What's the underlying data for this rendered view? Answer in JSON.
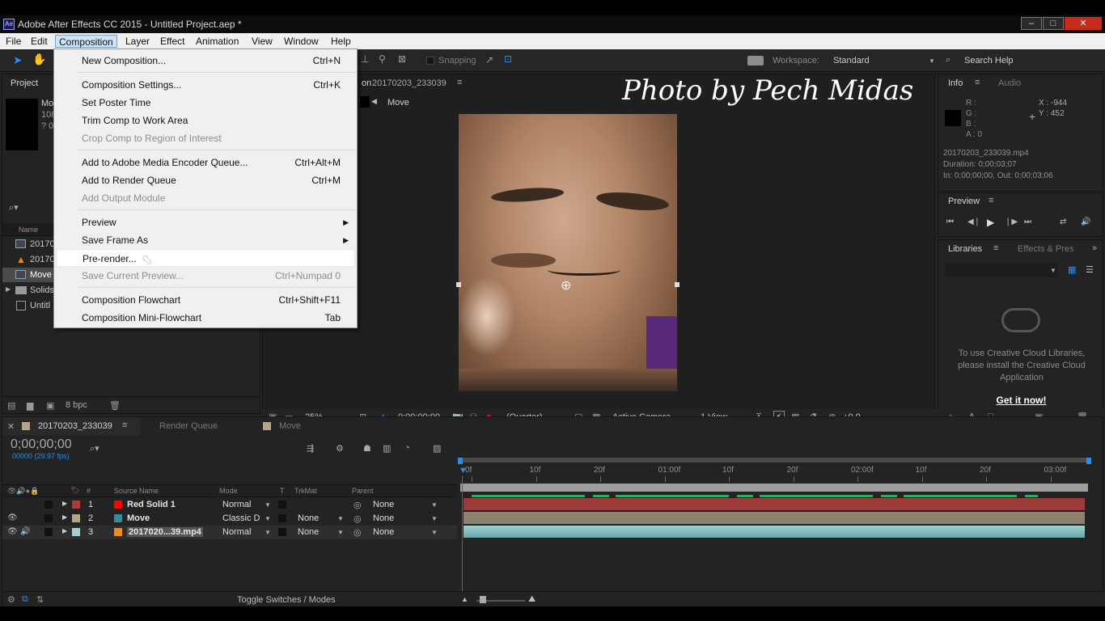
{
  "window": {
    "title": "Adobe After Effects CC 2015 - Untitled Project.aep *",
    "app_badge": "Ae",
    "min": "–",
    "max": "□",
    "close": "✕"
  },
  "menubar": {
    "items": [
      "File",
      "Edit",
      "Composition",
      "Layer",
      "Effect",
      "Animation",
      "View",
      "Window",
      "Help"
    ],
    "active": "Composition"
  },
  "toolbar": {
    "snapping": "Snapping",
    "workspace_label": "Workspace:",
    "workspace_value": "Standard",
    "search_help": "Search Help"
  },
  "menu": {
    "items": [
      {
        "label": "New Composition...",
        "shortcut": "Ctrl+N"
      },
      {
        "label": "Composition Settings...",
        "shortcut": "Ctrl+K"
      },
      {
        "label": "Set Poster Time",
        "shortcut": ""
      },
      {
        "label": "Trim Comp to Work Area",
        "shortcut": ""
      },
      {
        "label": "Crop Comp to Region of Interest",
        "shortcut": "",
        "disabled": true
      },
      {
        "label": "Add to Adobe Media Encoder Queue...",
        "shortcut": "Ctrl+Alt+M"
      },
      {
        "label": "Add to Render Queue",
        "shortcut": "Ctrl+M"
      },
      {
        "label": "Add Output Module",
        "shortcut": "",
        "disabled": true
      },
      {
        "label": "Preview",
        "shortcut": "",
        "submenu": true
      },
      {
        "label": "Save Frame As",
        "shortcut": "",
        "submenu": true
      },
      {
        "label": "Pre-render...",
        "shortcut": "",
        "highlighted": true
      },
      {
        "label": "Save Current Preview...",
        "shortcut": "Ctrl+Numpad 0",
        "disabled": true
      },
      {
        "label": "Composition Flowchart",
        "shortcut": "Ctrl+Shift+F11"
      },
      {
        "label": "Composition Mini-Flowchart",
        "shortcut": "Tab"
      }
    ]
  },
  "project": {
    "title": "Project",
    "info_name": "Mo",
    "info_line1": "108",
    "info_line2": "? 0;",
    "column_name": "Name",
    "bpc": "8 bpc",
    "items": [
      {
        "name": "20170",
        "icon": "composition-icon"
      },
      {
        "name": "20170",
        "icon": "vlc-footage-icon"
      },
      {
        "name": "Move",
        "icon": "composition-icon",
        "selected": true
      },
      {
        "name": "Solids",
        "icon": "folder-icon"
      },
      {
        "name": "Untitl",
        "icon": "project-file-icon"
      }
    ]
  },
  "composition": {
    "tab_prefix": "on",
    "comp_name": "20170203_233039",
    "breadcrumb": "Move",
    "watermark": "Photo by Pech Midas",
    "zoom": "25%",
    "timecode": "0;00;00;00",
    "resolution": "(Quarter)",
    "camera": "Active Camera",
    "views": "1 View",
    "exposure": "+0.0"
  },
  "info": {
    "tab_info": "Info",
    "tab_audio": "Audio",
    "r": "R :",
    "g": "G :",
    "b": "B :",
    "a": "A : 0",
    "x": "X : -944",
    "y": "Y : 452",
    "file": "20170203_233039.mp4",
    "duration": "Duration: 0;00;03;07",
    "inout": "In: 0;00;00;00, Out: 0;00;03;06"
  },
  "preview": {
    "title": "Preview"
  },
  "libraries": {
    "tab_libraries": "Libraries",
    "tab_effects": "Effects & Pres",
    "message": "To use Creative Cloud Libraries, please install the Creative Cloud Application",
    "link": "Get it now!"
  },
  "timeline": {
    "tabs": [
      {
        "label": "20170203_233039",
        "active": true
      },
      {
        "label": "Render Queue"
      },
      {
        "label": "Move"
      }
    ],
    "timecode": "0;00;00;00",
    "fps": "00000 (29.97 fps)",
    "columns": {
      "hash": "#",
      "source": "Source Name",
      "mode": "Mode",
      "t": "T",
      "trkmat": "TrkMat",
      "parent": "Parent"
    },
    "layers": [
      {
        "num": "1",
        "name": "Red Solid 1",
        "mode": "Normal",
        "trkmat": "",
        "parent": "None",
        "label_color": "#b33a3a",
        "icon_color": "#ff0000"
      },
      {
        "num": "2",
        "name": "Move",
        "mode": "Classic D",
        "trkmat": "None",
        "parent": "None",
        "label_color": "#b5a48a",
        "icon_color": "#3a8a9a"
      },
      {
        "num": "3",
        "name": "2017020...39.mp4",
        "mode": "Normal",
        "trkmat": "None",
        "parent": "None",
        "label_color": "#a6d0d0",
        "icon_color": "#f08a1a",
        "selected": true
      }
    ],
    "ruler": [
      "0f",
      "10f",
      "20f",
      "01:00f",
      "10f",
      "20f",
      "02:00f",
      "10f",
      "20f",
      "03:00f"
    ],
    "footer": "Toggle Switches / Modes"
  },
  "colors": {
    "accent": "#2d8ceb",
    "panel": "#232323",
    "menu": "#f0f0f0"
  }
}
